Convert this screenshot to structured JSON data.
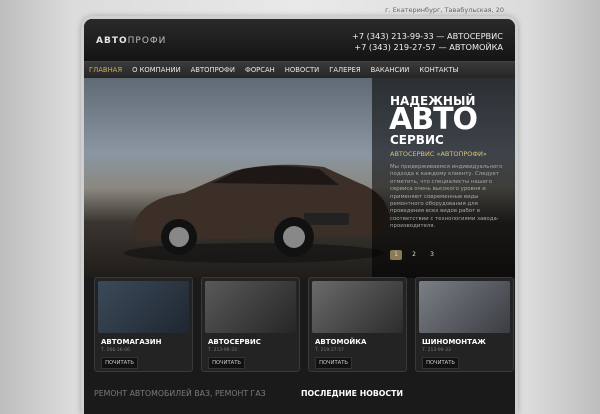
{
  "address": "г. Екатеринбург, Тавабульская, 20",
  "logo": {
    "part1": "АВТО",
    "part2": "ПРОФИ"
  },
  "phones": [
    "+7 (343) 213-99-33 — АВТОСЕРВИС",
    "+7 (343) 219-27-57 — АВТОМОЙКА"
  ],
  "nav": [
    "ГЛАВНАЯ",
    "О КОМПАНИИ",
    "АВТОПРОФИ",
    "ФОРСАН",
    "НОВОСТИ",
    "ГАЛЕРЕЯ",
    "ВАКАНСИИ",
    "КОНТАКТЫ"
  ],
  "hero": {
    "line1": "НАДЕЖНЫЙ",
    "line2": "АВТО",
    "line3": "СЕРВИС",
    "subtitle": "АВТОСЕРВИС «АВТОПРОФИ»",
    "description": "Мы придерживаемся индивидуального подхода к каждому клиенту. Следует отметить, что специалисты нашего сервиса очень высокого уровня и применяют современные виды ремонтного оборудования для проведения всех видов работ в соответствии с технологиями завода-производителя.",
    "pages": [
      "1",
      "2",
      "3"
    ],
    "active_page": "1"
  },
  "tiles": [
    {
      "title": "АВТОМАГАЗИН",
      "phone": "Т. 266-16-06",
      "button": "ПОЧИТАТЬ"
    },
    {
      "title": "АВТОСЕРВИС",
      "phone": "Т. 213-99-33",
      "button": "ПОЧИТАТЬ"
    },
    {
      "title": "АВТОМОЙКА",
      "phone": "Т. 219-27-57",
      "button": "ПОЧИТАТЬ"
    },
    {
      "title": "ШИНОМОНТАЖ",
      "phone": "Т. 213-99-33",
      "button": "ПОЧИТАТЬ"
    }
  ],
  "bottom": {
    "left": "РЕМОНТ АВТОМОБИЛЕЙ ВАЗ, РЕМОНТ ГАЗ",
    "right": "ПОСЛЕДНИЕ НОВОСТИ"
  },
  "colors": {
    "accent": "#c9ad57",
    "frame": "#1a1a1a",
    "page_bg": "#e0e0e0"
  }
}
